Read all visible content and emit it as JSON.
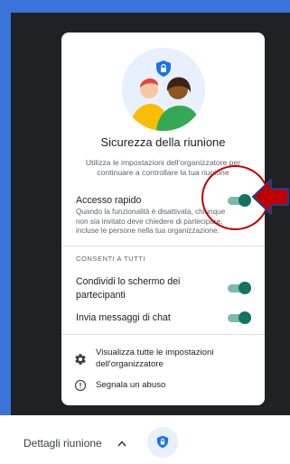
{
  "panel": {
    "title": "Sicurezza della riunione",
    "description": "Utilizza le impostazioni dell'organizzatore per continuare a controllare la tua riunione"
  },
  "quick_access": {
    "label": "Accesso rapido",
    "help": "Quando la funzionalità è disattivata, chiunque non sia invitato deve chiedere di partecipare, incluse le persone nella tua organizzazione.",
    "enabled": true
  },
  "section": {
    "header": "CONSENTI A TUTTI"
  },
  "settings": [
    {
      "label": "Condividi lo schermo dei partecipanti",
      "enabled": true
    },
    {
      "label": "Invia messaggi di chat",
      "enabled": true
    }
  ],
  "links": {
    "view_all": "Visualizza tutte le impostazioni dell'organizzatore",
    "report_abuse": "Segnala un abuso"
  },
  "bottom_bar": {
    "details_label": "Dettagli riunione"
  },
  "colors": {
    "toggle_on_knob": "#137363",
    "toggle_on_track": "#7cb9ad",
    "annotation_red": "#c00000",
    "shield_blue": "#1a73e8"
  },
  "icons": [
    "shield-icon",
    "gear-icon",
    "info-icon",
    "chevron-up-icon"
  ]
}
